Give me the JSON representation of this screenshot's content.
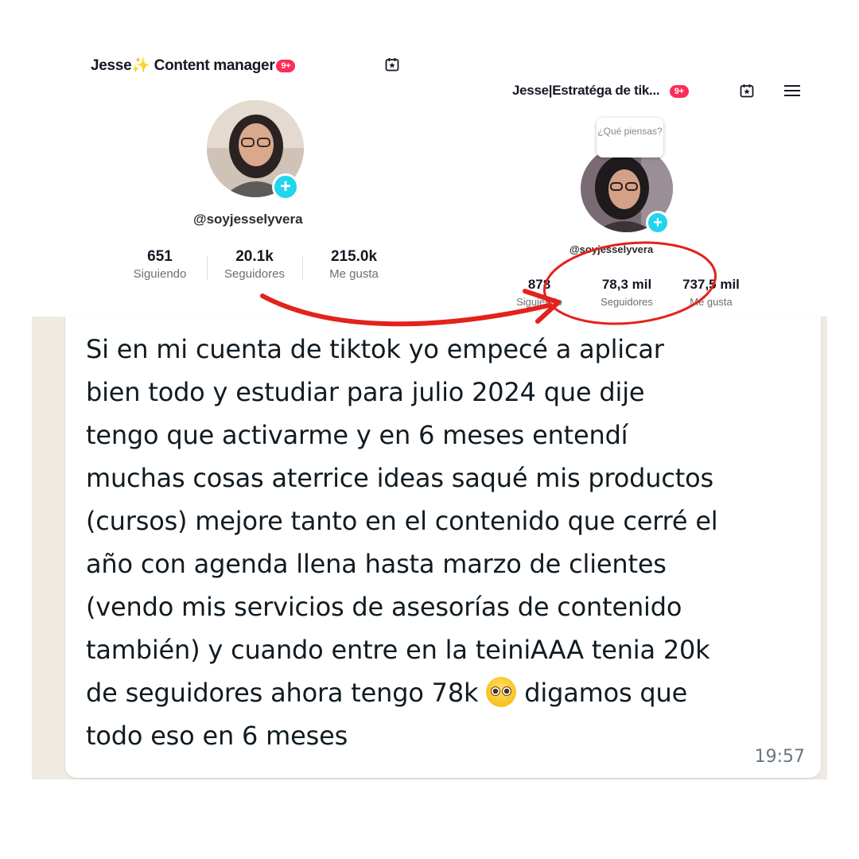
{
  "left_profile": {
    "title": "Jesse✨ Content manager",
    "badge": "9+",
    "handle": "@soyjesselyvera",
    "stats": [
      {
        "value": "651",
        "label": "Siguiendo"
      },
      {
        "value": "20.1k",
        "label": "Seguidores"
      },
      {
        "value": "215.0k",
        "label": "Me gusta"
      }
    ],
    "icons": [
      "calendar-star-icon",
      "plus-icon"
    ]
  },
  "right_profile": {
    "title": "Jesse|Estratéga de tik...",
    "badge": "9+",
    "bubble_text": "¿Qué piensas?",
    "handle": "@soyjesselyvera",
    "stats": [
      {
        "value": "878",
        "label": "Siguiendo"
      },
      {
        "value": "78,3 mil",
        "label": "Seguidores"
      },
      {
        "value": "737,5 mil",
        "label": "Me gusta"
      }
    ],
    "icons": [
      "calendar-star-icon",
      "menu-icon",
      "plus-icon"
    ]
  },
  "chat": {
    "lines": [
      "Si en mi cuenta de tiktok yo empecé a aplicar",
      "bien todo y estudiar para julio 2024 que dije",
      "tengo que activarme y en 6 meses entendí",
      "muchas cosas aterrice ideas saqué mis productos",
      "(cursos) mejore tanto en el contenido que cerré el",
      "año con agenda llena hasta marzo de clientes",
      "(vendo mis servicios de asesorías de contenido",
      "también) y cuando entre en la teiniAAA tenia 20k"
    ],
    "line9_before": "de seguidores ahora tengo 78k",
    "line9_after": "digamos que",
    "line10": "todo eso en 6 meses",
    "time": "19:57",
    "emoji": "pleading-face-emoji"
  },
  "colors": {
    "annotation": "#e3221c",
    "plus_badge": "#20d5ec",
    "notification_badge": "#fe2c55",
    "chat_background": "#efeae2"
  }
}
